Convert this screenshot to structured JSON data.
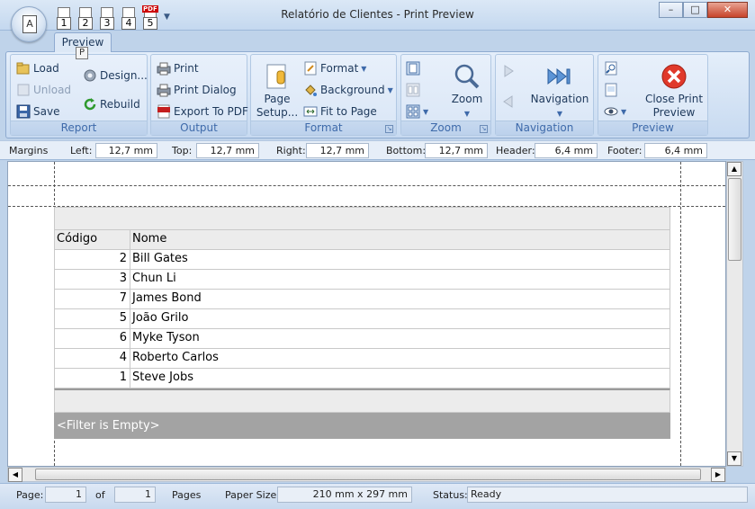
{
  "window": {
    "title": "Relatório de Clientes - Print Preview",
    "minimize": "–",
    "maximize": "□",
    "close": "✕"
  },
  "app_menu": {
    "glyph": "A"
  },
  "quick_access": [
    {
      "label": "1"
    },
    {
      "label": "2"
    },
    {
      "label": "3"
    },
    {
      "label": "4"
    },
    {
      "label": "5",
      "badge": "PDF"
    }
  ],
  "tabs": {
    "active": "Preview",
    "keytip": "P"
  },
  "ribbon": {
    "report": {
      "label": "Report",
      "load": "Load",
      "unload": "Unload",
      "save": "Save",
      "design": "Design...",
      "rebuild": "Rebuild"
    },
    "output": {
      "label": "Output",
      "print": "Print",
      "print_dialog": "Print Dialog",
      "export_pdf": "Export To PDF"
    },
    "format": {
      "label": "Format",
      "page_setup": "Page Setup...",
      "format": "Format",
      "background": "Background",
      "fit_to_page": "Fit to Page"
    },
    "zoom": {
      "label": "Zoom",
      "zoom": "Zoom"
    },
    "navigation": {
      "label": "Navigation",
      "navigation": "Navigation"
    },
    "preview": {
      "label": "Preview",
      "close": "Close Print Preview"
    }
  },
  "margins": {
    "label": "Margins",
    "left_label": "Left:",
    "left": "12,7 mm",
    "top_label": "Top:",
    "top": "12,7 mm",
    "right_label": "Right:",
    "right": "12,7 mm",
    "bottom_label": "Bottom:",
    "bottom": "12,7 mm",
    "header_label": "Header:",
    "header": "6,4 mm",
    "footer_label": "Footer:",
    "footer": "6,4 mm"
  },
  "grid": {
    "columns": [
      "Código",
      "Nome"
    ],
    "rows": [
      {
        "codigo": "2",
        "nome": "Bill Gates"
      },
      {
        "codigo": "3",
        "nome": "Chun Li"
      },
      {
        "codigo": "7",
        "nome": "James Bond"
      },
      {
        "codigo": "5",
        "nome": "João Grilo"
      },
      {
        "codigo": "6",
        "nome": "Myke Tyson"
      },
      {
        "codigo": "4",
        "nome": "Roberto Carlos"
      },
      {
        "codigo": "1",
        "nome": "Steve Jobs"
      }
    ],
    "filter": "<Filter is Empty>"
  },
  "status": {
    "page_label": "Page:",
    "page": "1",
    "of_label": "of",
    "total": "1",
    "pages_label": "Pages",
    "paper_label": "Paper Size:",
    "paper": "210 mm x 297 mm",
    "status_label": "Status:",
    "status": "Ready"
  }
}
